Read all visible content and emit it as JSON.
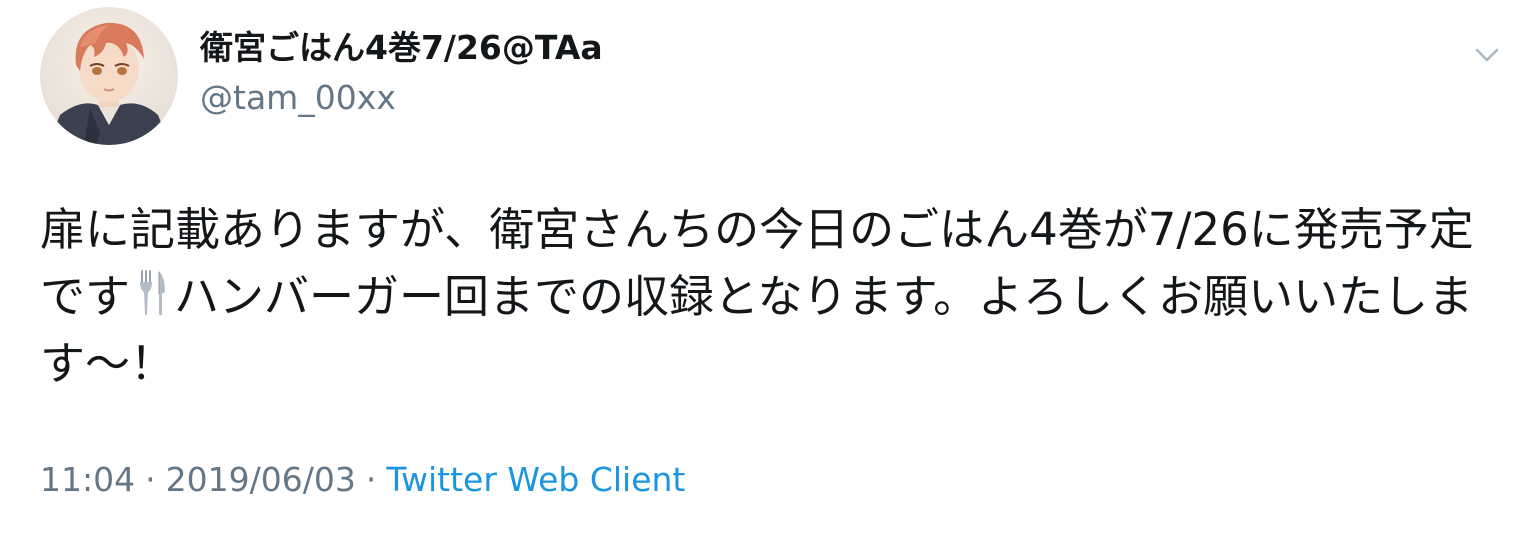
{
  "tweet": {
    "author": {
      "display_name": "衛宮ごはん4巻7/26@TAa",
      "handle": "@tam_00xx",
      "avatar_icon": "avatar-illustration"
    },
    "menu_icon": "chevron-down-icon",
    "text": {
      "before_emoji": "扉に記載ありますが、衛宮さんちの今日のごはん4巻が7/26に発売予定です",
      "emoji_icon": "fork-and-knife-icon",
      "after_emoji": "ハンバーガー回までの収録となります。よろしくお願いいたします〜！"
    },
    "meta": {
      "time": "11:04",
      "separator": "·",
      "date": "2019/06/03",
      "source": "Twitter Web Client"
    }
  },
  "colors": {
    "text_primary": "#14171a",
    "text_secondary": "#657786",
    "link": "#1b95e0",
    "background": "#ffffff"
  }
}
